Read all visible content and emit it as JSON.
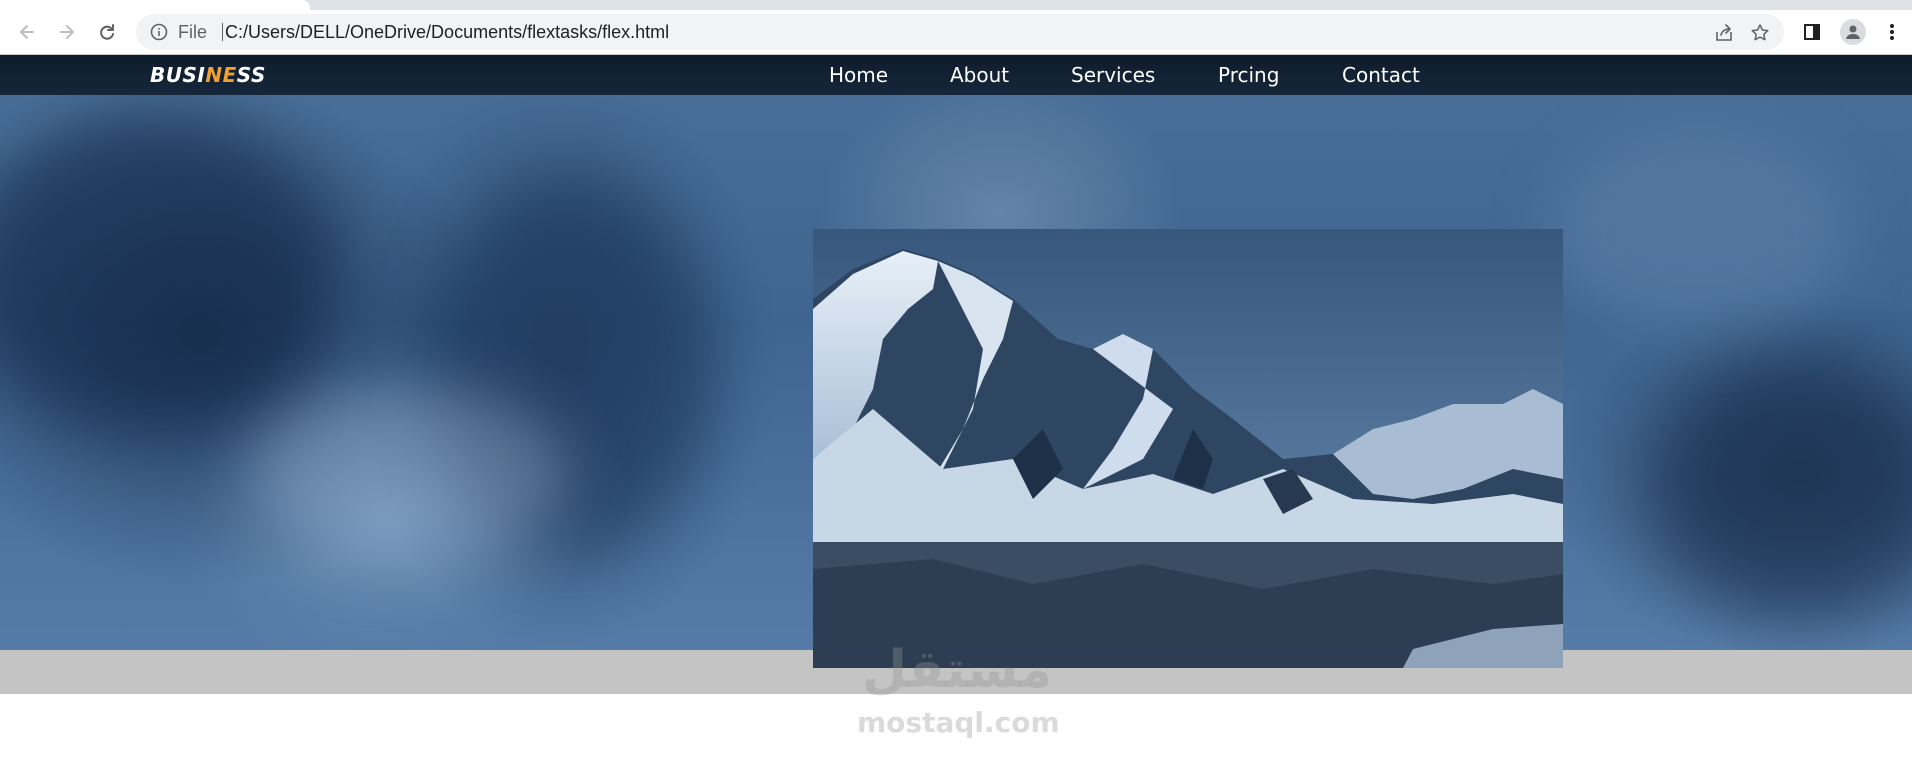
{
  "browser": {
    "info_label": "File",
    "url": "C:/Users/DELL/OneDrive/Documents/flextasks/flex.html",
    "icons": [
      "back-icon",
      "forward-icon",
      "reload-icon",
      "info-icon",
      "share-icon",
      "bookmark-star-icon",
      "side-panel-icon",
      "profile-icon",
      "menu-icon"
    ]
  },
  "site": {
    "logo": {
      "part1": "BUSI",
      "part2": "NE",
      "part3": "SS",
      "accent_color": "#f0a030"
    },
    "nav": [
      "Home",
      "About",
      "Services",
      "Prcing",
      "Contact"
    ]
  },
  "watermark": {
    "arabic": "مستقل",
    "latin": "mostaql.com"
  },
  "colors": {
    "navbar": "#0e1b2c",
    "band": "#c4c4c4",
    "hero": "#4a6f98"
  }
}
